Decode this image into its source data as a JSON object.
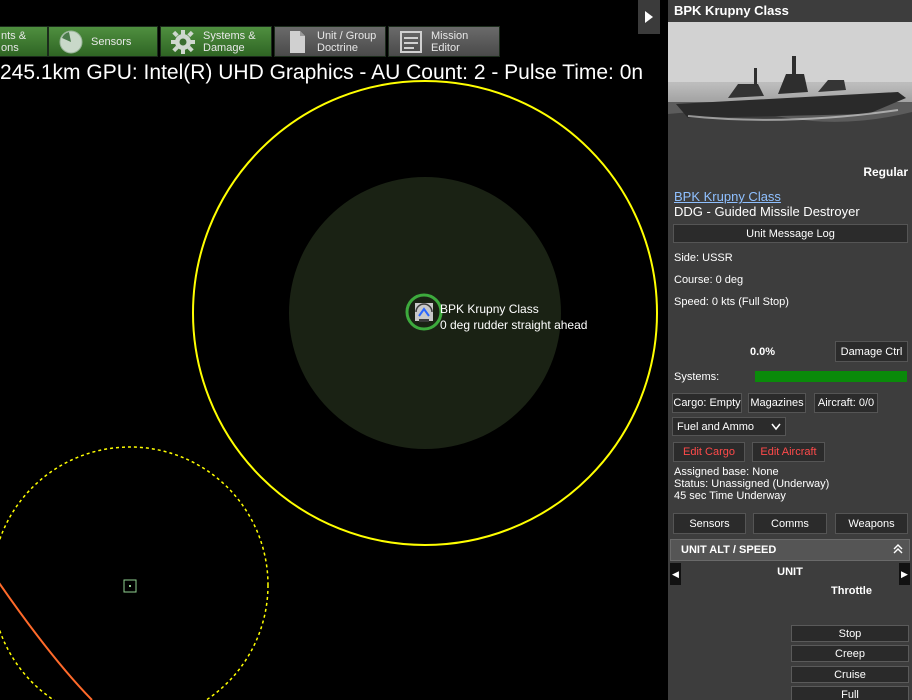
{
  "tabs": [
    {
      "label": "nts &\nons",
      "icon": "weapons-icon"
    },
    {
      "label": "Sensors",
      "icon": "radar-icon"
    },
    {
      "label": "Systems &\nDamage",
      "icon": "gear-icon"
    },
    {
      "label": "Unit / Group\nDoctrine",
      "icon": "document-icon"
    },
    {
      "label": "Mission\nEditor",
      "icon": "mission-editor-icon"
    }
  ],
  "map": {
    "status_text": "245.1km GPU: Intel(R) UHD Graphics - AU Count: 2 - Pulse Time: 0n",
    "unit_name": "BPK Krupny Class",
    "unit_status": "0 deg  rudder straight ahead",
    "colors": {
      "range_ring": "#ffff00",
      "unit_marker": "#3daa3d",
      "contact_line": "#ff6a2a"
    }
  },
  "panel": {
    "title": "BPK Krupny Class",
    "proficiency": "Regular",
    "class_link": "BPK Krupny Class",
    "unit_type": "DDG - Guided Missile Destroyer",
    "message_log_btn": "Unit Message Log",
    "side": "Side: USSR",
    "course": "Course: 0 deg",
    "speed": "Speed: 0 kts (Full Stop)",
    "damage_pct": "0.0%",
    "damage_ctrl_btn": "Damage Ctrl",
    "systems_label": "Systems:",
    "cargo_btn": "Cargo: Empty",
    "magazines_btn": "Magazines",
    "aircraft_btn": "Aircraft: 0/0",
    "fuel_select": "Fuel and Ammo",
    "edit_cargo_btn": "Edit Cargo",
    "edit_aircraft_btn": "Edit Aircraft",
    "assigned_base": "Assigned base: None",
    "status": "Status: Unassigned (Underway)",
    "time_underway": "45 sec Time Underway",
    "sensors_btn": "Sensors",
    "comms_btn": "Comms",
    "weapons_btn": "Weapons",
    "alt_speed_header": "UNIT ALT / SPEED",
    "unit_label": "UNIT",
    "throttle_label": "Throttle",
    "speed_buttons": [
      "Stop",
      "Creep",
      "Cruise",
      "Full"
    ]
  }
}
